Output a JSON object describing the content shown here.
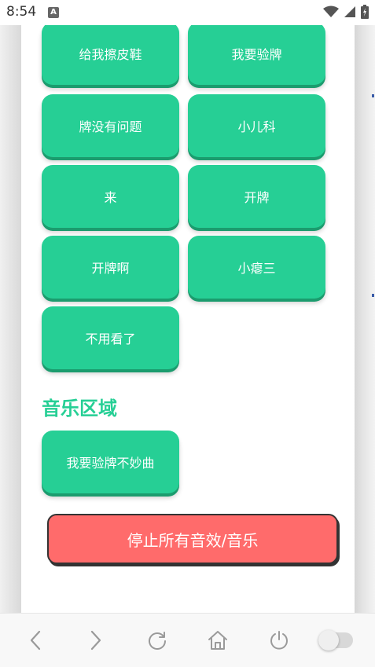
{
  "status_bar": {
    "time": "8:54",
    "notification_letter": "A"
  },
  "sound_buttons": [
    {
      "label": "给我擦皮鞋"
    },
    {
      "label": "我要验牌"
    },
    {
      "label": "牌没有问题"
    },
    {
      "label": "小儿科"
    },
    {
      "label": "来"
    },
    {
      "label": "开牌"
    },
    {
      "label": "开牌啊"
    },
    {
      "label": "小瘪三"
    },
    {
      "label": "不用看了"
    }
  ],
  "music_section": {
    "title": "音乐区域",
    "buttons": [
      {
        "label": "我要验牌不妙曲"
      }
    ]
  },
  "stop_button": {
    "label": "停止所有音效/音乐"
  },
  "bottom_nav": {
    "icons": [
      "back-icon",
      "forward-icon",
      "reload-icon",
      "home-icon",
      "power-icon",
      "toggle-switch"
    ]
  },
  "colors": {
    "accent_green": "#26cf95",
    "stop_red": "#ff6b6b"
  }
}
